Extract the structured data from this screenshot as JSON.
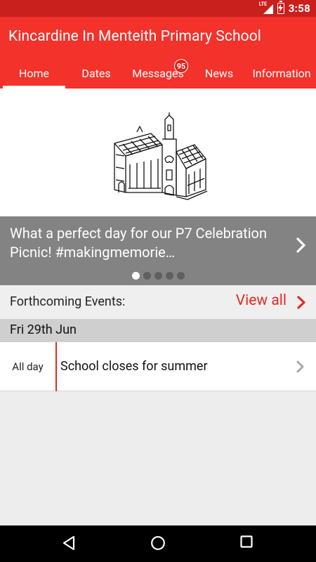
{
  "status_bar": {
    "time": "3:58",
    "network": "LTE",
    "icons": [
      "lte-signal-icon",
      "battery-charging-icon"
    ]
  },
  "app": {
    "title": "Kincardine In Menteith Primary School",
    "colors": {
      "primary": "#f2322b",
      "status_bar": "#c9201e",
      "accent": "#e32a22"
    }
  },
  "tabs": [
    {
      "label": "Home",
      "active": true
    },
    {
      "label": "Dates"
    },
    {
      "label": "Messages",
      "badge": "95"
    },
    {
      "label": "News"
    },
    {
      "label": "Information"
    }
  ],
  "hero": {
    "image": "school-building-sketch"
  },
  "carousel": {
    "caption": "What a perfect day for our P7 Celebration Picnic! #makingmemorie…",
    "active_slide": 1,
    "total_slides": 5
  },
  "events": {
    "title": "Forthcoming Events:",
    "view_all": "View all",
    "date": "Fri 29th Jun",
    "items": [
      {
        "time": "All day",
        "name": "School closes for summer"
      }
    ]
  },
  "nav_bar": {
    "buttons": [
      "back-icon",
      "home-icon",
      "recents-icon"
    ]
  }
}
